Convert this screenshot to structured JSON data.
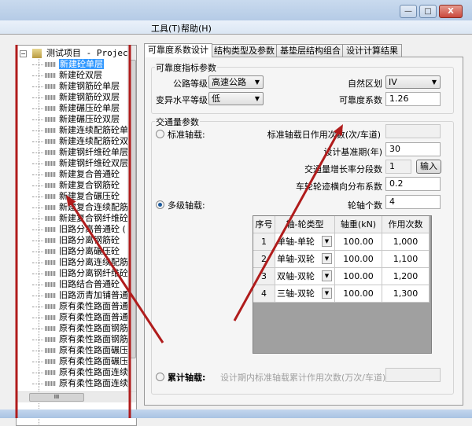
{
  "window": {
    "minimize": "—",
    "maximize": "□",
    "close": "X",
    "close_color": "#c9483c"
  },
  "menu": {
    "items": [
      {
        "label": "工具(T)"
      },
      {
        "label": "帮助(H)"
      }
    ]
  },
  "tree": {
    "root": "测试项目 - Project",
    "selected_index": 0,
    "items": [
      "新建砼单层",
      "新建砼双层",
      "新建钢筋砼单层",
      "新建钢筋砼双层",
      "新建碾压砼单层",
      "新建碾压砼双层",
      "新建连续配筋砼单",
      "新建连续配筋砼双",
      "新建钢纤维砼单层",
      "新建钢纤维砼双层",
      "新建复合普通砼",
      "新建复合钢筋砼",
      "新建复合碾压砼",
      "新建复合连续配筋",
      "新建复合钢纤维砼",
      "旧路分离普通砼 (",
      "旧路分离钢筋砼",
      "旧路分离碾压砼",
      "旧路分离连续配筋",
      "旧路分离钢纤维砼",
      "旧路结合普通砼",
      "旧路沥青加铺普通",
      "原有柔性路面普通",
      "原有柔性路面普通",
      "原有柔性路面钢筋",
      "原有柔性路面钢筋",
      "原有柔性路面碾压",
      "原有柔性路面碾压",
      "原有柔性路面连续",
      "原有柔性路面连续"
    ],
    "hscroll_thumb": "III"
  },
  "tabs": [
    {
      "label": "可靠度系数设计",
      "active": true
    },
    {
      "label": "结构类型及参数"
    },
    {
      "label": "基垫层结构组合"
    },
    {
      "label": "设计计算结果"
    }
  ],
  "reliability": {
    "group_title": "可靠度指标参数",
    "road_grade_label": "公路等级",
    "road_grade_value": "高速公路",
    "variation_label": "变异水平等级",
    "variation_value": "低",
    "zone_label": "自然区划",
    "zone_value": "IV",
    "coef_label": "可靠度系数",
    "coef_value": "1.26"
  },
  "traffic": {
    "group_title": "交通量参数",
    "standard_radio": "标准轴载:",
    "std_daily_label": "标准轴载日作用次数(次/车道)",
    "std_daily_value": "",
    "period_label": "设计基准期(年)",
    "period_value": "30",
    "growth_label": "交通量增长率分段数",
    "growth_value": "1",
    "input_button": "输入",
    "wheel_label": "车轮轮迹横向分布系数",
    "wheel_value": "0.2",
    "multi_radio": "多级轴载:",
    "multi_selected": true,
    "axle_count_label": "轮轴个数",
    "axle_count_value": "4",
    "cumulative_radio": "累计轴载:",
    "cumulative_label": "设计期内标准轴载累计作用次数(万次/车道)",
    "cumulative_value": ""
  },
  "axle_table": {
    "headers": [
      "序号",
      "轴-轮类型",
      "轴重(kN)",
      "作用次数"
    ],
    "rows": [
      {
        "no": "1",
        "type": "单轴-单轮",
        "weight": "100.00",
        "count": "1,000"
      },
      {
        "no": "2",
        "type": "单轴-双轮",
        "weight": "100.00",
        "count": "1,100"
      },
      {
        "no": "3",
        "type": "双轴-双轮",
        "weight": "100.00",
        "count": "1,200"
      },
      {
        "no": "4",
        "type": "三轴-双轮",
        "weight": "100.00",
        "count": "1,300"
      }
    ]
  },
  "annotation_color": "#b01c1c"
}
